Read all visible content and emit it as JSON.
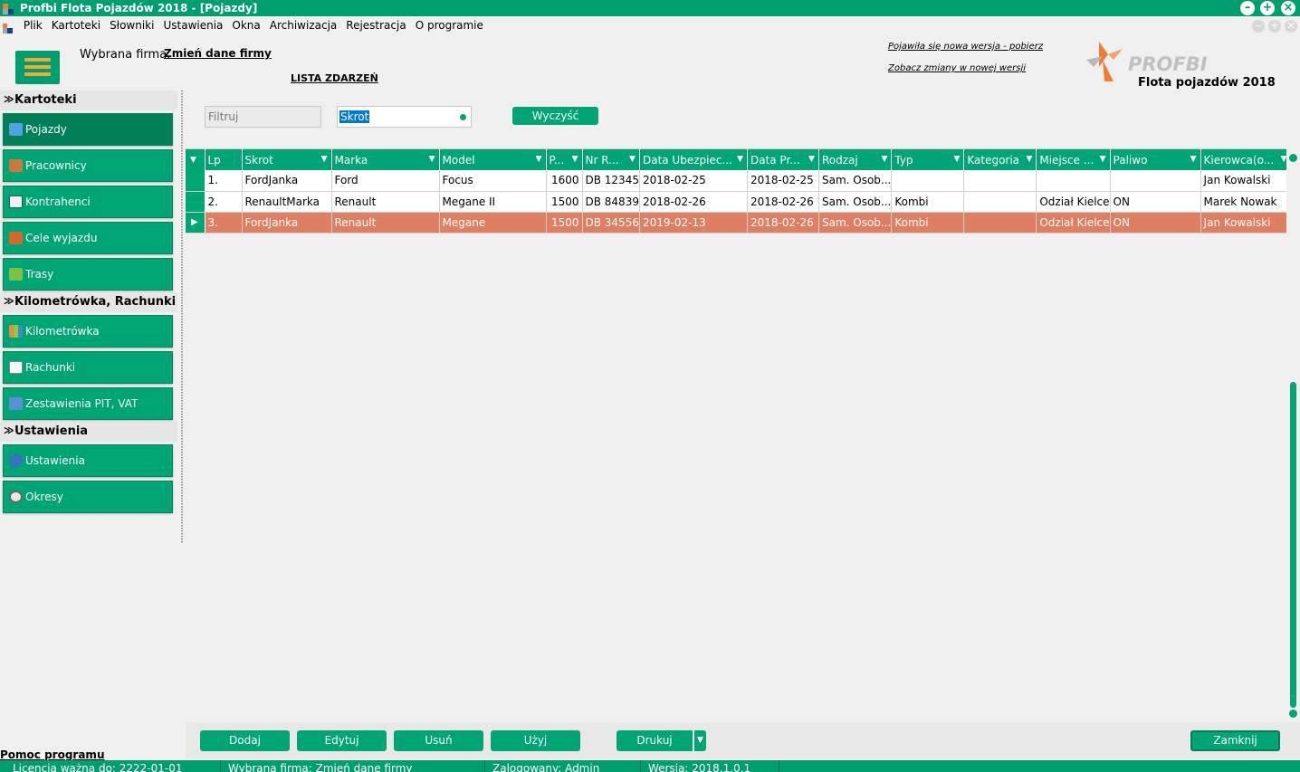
{
  "window": {
    "title": "Profbi Flota Pojazdów 2018 - [Pojazdy]"
  },
  "menu": [
    "Plik",
    "Kartoteki",
    "Słowniki",
    "Ustawienia",
    "Okna",
    "Archiwizacja",
    "Rejestracja",
    "O programie"
  ],
  "header": {
    "firm_label": "Wybrana firma:",
    "firm_link": "Zmień dane firmy",
    "events_link": "LISTA ZDARZEŃ",
    "new_version": "Pojawiła się nowa wersja - pobierz",
    "see_changes": "Zobacz zmiany w nowej wersji",
    "logo_text": "PROFBI",
    "logo_subtitle": "Flota pojazdów 2018"
  },
  "sidebar": {
    "sections": [
      {
        "title": "Kartoteki",
        "items": [
          "Pojazdy",
          "Pracownicy",
          "Kontrahenci",
          "Cele wyjazdu",
          "Trasy"
        ]
      },
      {
        "title": "Kilometrówka, Rachunki",
        "items": [
          "Kilometrówka",
          "Rachunki",
          "Zestawienia PIT, VAT"
        ]
      },
      {
        "title": "Ustawienia",
        "items": [
          "Ustawienia",
          "Okresy"
        ]
      }
    ],
    "active_item": "Pojazdy"
  },
  "filter": {
    "placeholder": "Filtruj",
    "combo_value": "Skrot",
    "clear_label": "Wyczyść"
  },
  "grid": {
    "columns": [
      "Lp",
      "Skrot",
      "Marka",
      "Model",
      "P...",
      "Nr R...",
      "Data Ubezpiec...",
      "Data Pr...",
      "Rodzaj",
      "Typ",
      "Kategoria",
      "Miejsce ...",
      "Paliwo",
      "Kierowca(o..."
    ],
    "rows": [
      [
        "1.",
        "FordJanka",
        "Ford",
        "Focus",
        "1600",
        "DB 12345",
        "2018-02-25",
        "2018-02-25",
        "Sam. Osob...",
        "",
        "",
        "",
        "",
        "Jan Kowalski"
      ],
      [
        "2.",
        "RenaultMarka",
        "Renault",
        "Megane II",
        "1500",
        "DB 84839",
        "2018-02-26",
        "2018-02-26",
        "Sam. Osob...",
        "Kombi",
        "",
        "Odział Kielce",
        "ON",
        "Marek Nowak"
      ],
      [
        "3.",
        "FordJanka",
        "Renault",
        "Megane",
        "1500",
        "DB 34556",
        "2019-02-13",
        "2018-02-26",
        "Sam. Osob...",
        "Kombi",
        "",
        "Odział Kielce",
        "ON",
        "Jan Kowalski"
      ]
    ],
    "selected_row": 3
  },
  "buttons": {
    "add": "Dodaj",
    "edit": "Edytuj",
    "delete": "Usuń",
    "use": "Użyj",
    "print": "Drukuj",
    "close": "Zamknij"
  },
  "help": "Pomoc programu",
  "status": {
    "license": "Licencja ważna do: 2222-01-01",
    "firm": "Wybrana firma: Zmień dane firmy",
    "user": "Zalogowany: Admin",
    "version": "Wersja: 2018.1.0.1"
  },
  "colors": {
    "primary": "#00a575",
    "titlebar": "#009e6e",
    "selected_row": "#e07e62",
    "logo_orange": "#f07d33"
  }
}
